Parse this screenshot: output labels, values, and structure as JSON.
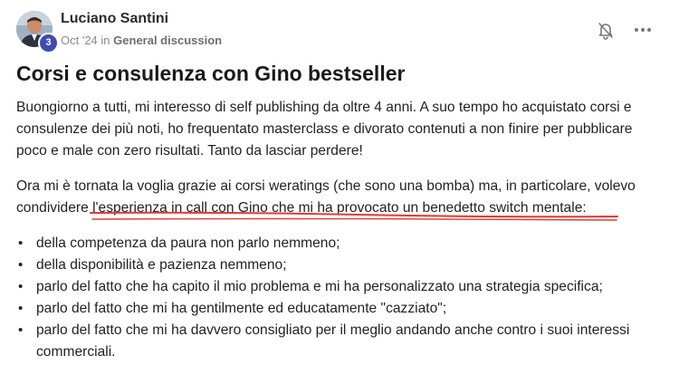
{
  "author": {
    "name": "Luciano Santini",
    "level": "3",
    "date": "Oct '24",
    "in_text": "in",
    "category": "General discussion"
  },
  "icons": {
    "bell": "bell-icon",
    "more": "more-horizontal-icon"
  },
  "post": {
    "title": "Corsi e consulenza con Gino bestseller",
    "paragraph1": "Buongiorno a tutti, mi interesso di self publishing da oltre 4 anni. A suo tempo ho acquistato corsi e consulenze dei più noti, ho frequentato masterclass e divorato contenuti a non finire per pubblicare poco e male con zero risultati. Tanto da lasciar perdere!",
    "paragraph2_start": "Ora mi è tornata la voglia grazie ai corsi weratings (che sono una bomba) ma, in particolare, volevo condividere l'",
    "paragraph2_highlight": "esperienza in call con Gino che mi ha provocato un benedetto switch mentale",
    "paragraph2_end": ":",
    "points": [
      "della competenza da paura non parlo nemmeno;",
      "della disponibilità e pazienza nemmeno;",
      "parlo del fatto che ha capito il mio problema e mi ha personalizzato una strategia specifica;",
      "parlo del fatto che mi ha gentilmente ed educatamente \"cazziato\";",
      "parlo del fatto che mi ha davvero consigliato per il meglio andando anche contro i suoi interessi commerciali."
    ]
  },
  "colors": {
    "underline": "#e53935",
    "badge": "#3f4bb3"
  }
}
